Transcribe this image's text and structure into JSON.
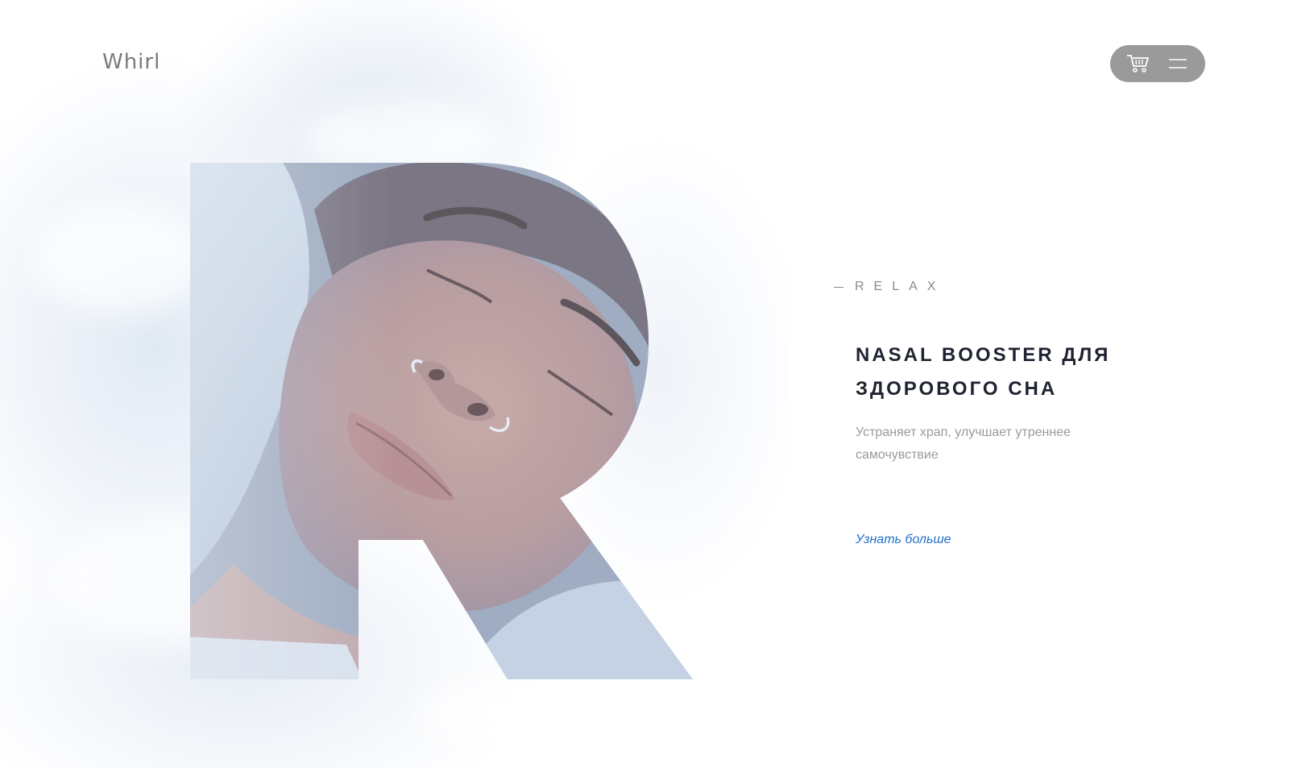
{
  "brand": {
    "logo_text": "Whirl"
  },
  "header": {
    "cart_icon": "cart-icon",
    "menu_icon": "hamburger-menu-icon",
    "pill_color": "#9a9a9a"
  },
  "hero": {
    "letter": "R",
    "eyebrow": "RELAX",
    "headline": "NASAL BOOSTER ДЛЯ ЗДОРОВОГО СНА",
    "subtext": "Устраняет храп, улучшает утреннее самочувствие",
    "cta_label": "Узнать больше",
    "cta_color": "#1f6fc9"
  }
}
